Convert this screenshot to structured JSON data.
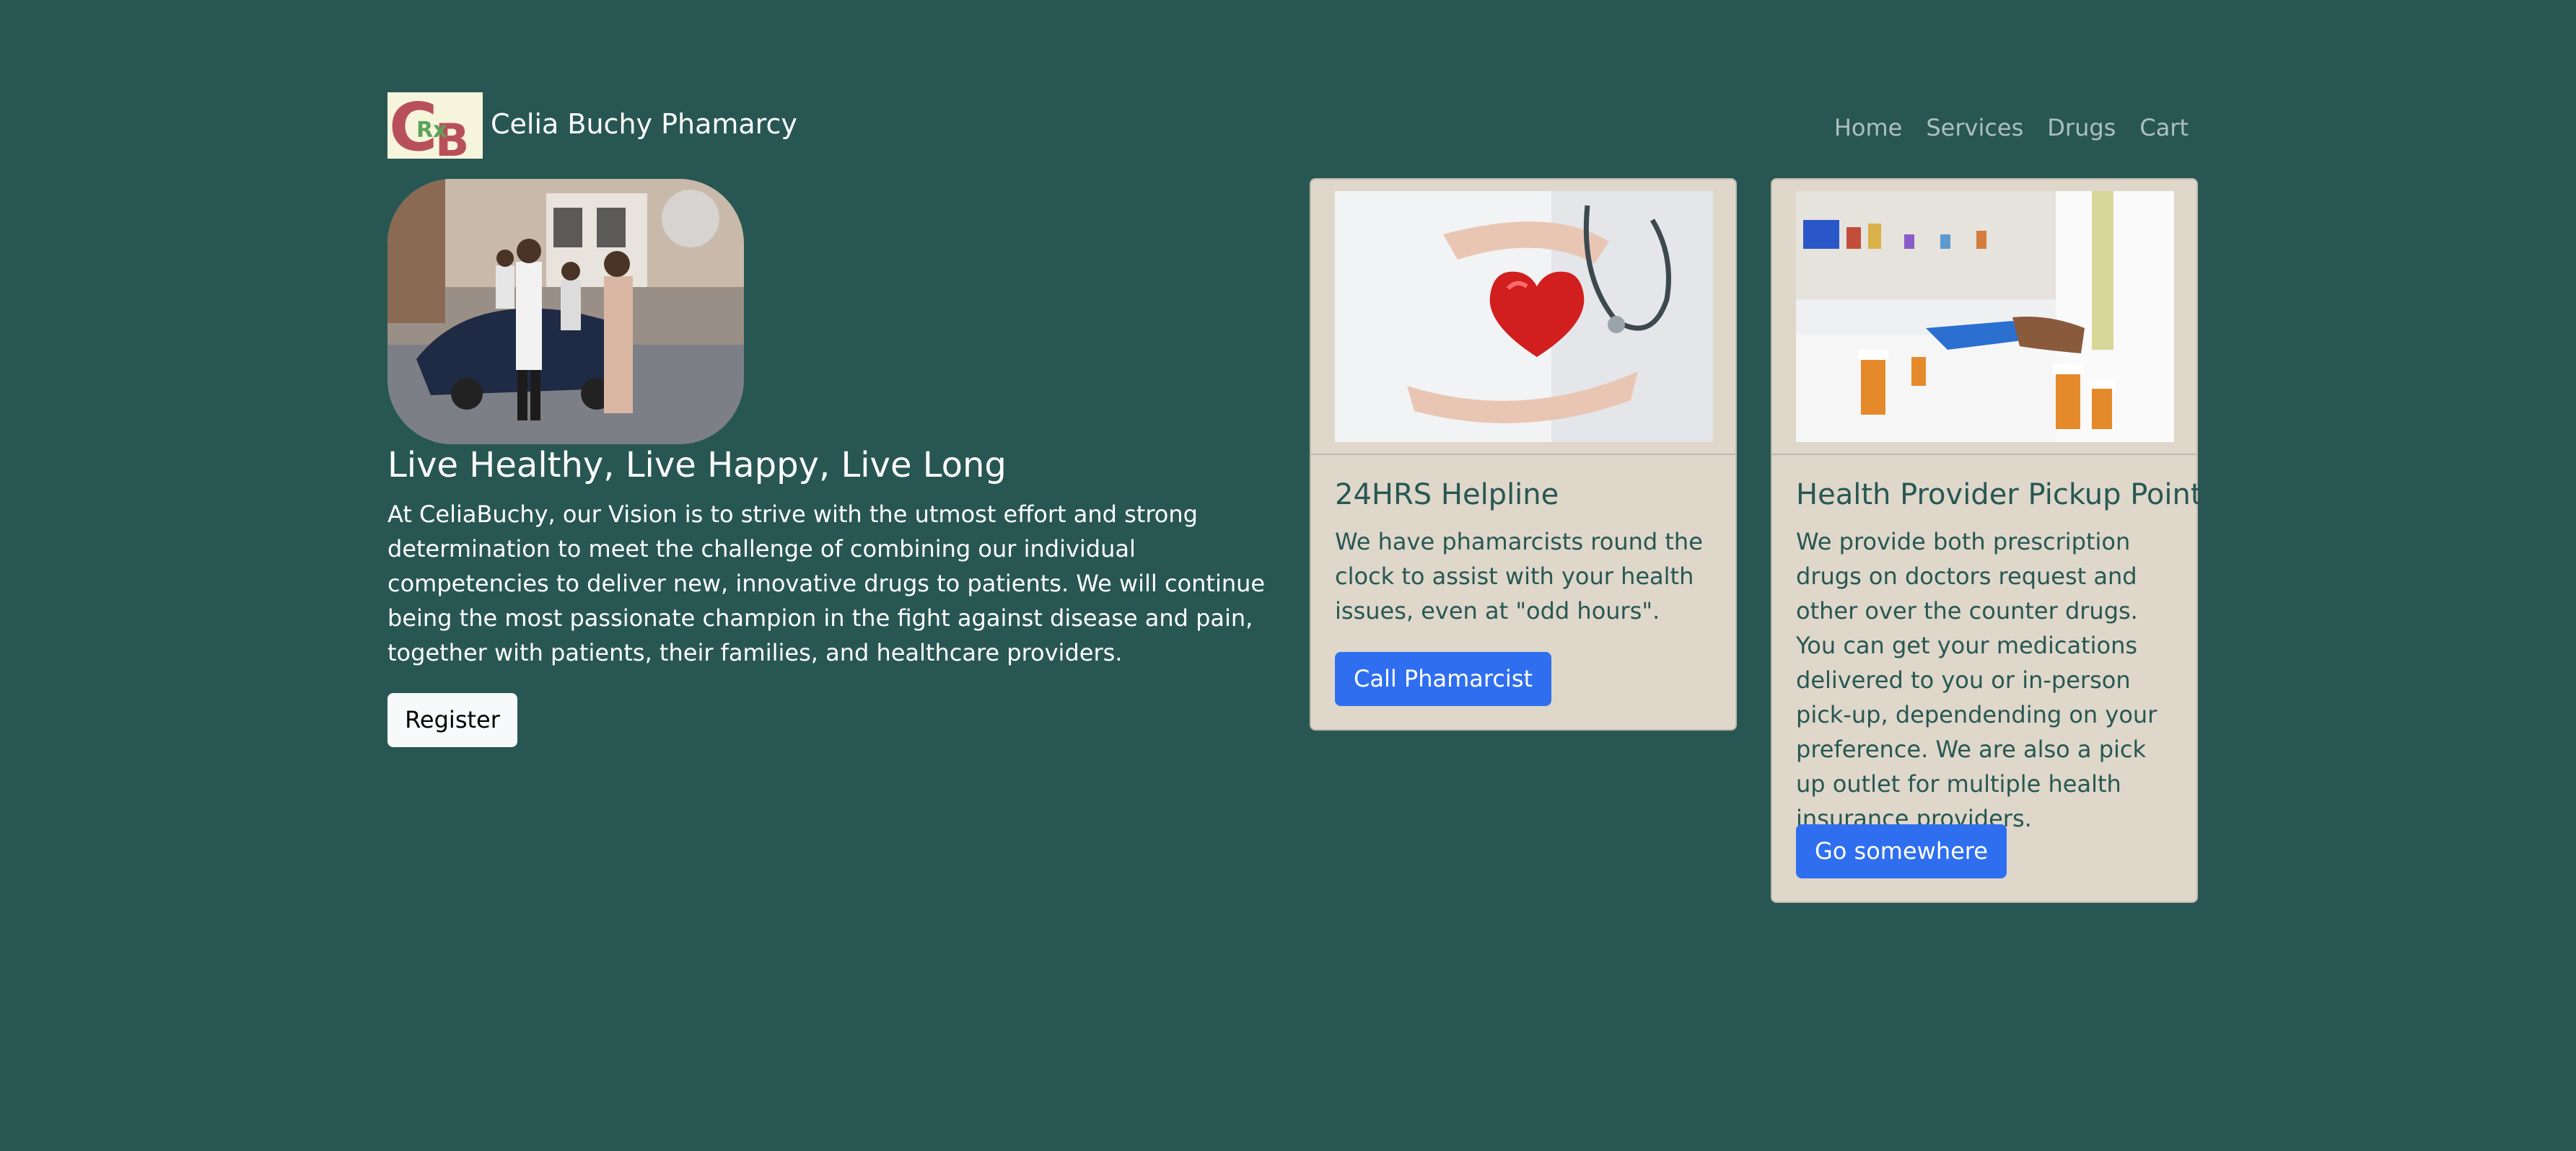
{
  "header": {
    "logo_alt": "CB logo",
    "brand": "Celia Buchy Phamarcy",
    "nav": [
      {
        "label": "Home"
      },
      {
        "label": "Services"
      },
      {
        "label": "Drugs"
      },
      {
        "label": "Cart"
      }
    ]
  },
  "hero": {
    "image_alt": "family photo",
    "title": "Live Healthy, Live Happy, Live Long",
    "text": "At CeliaBuchy, our Vision is to strive with the utmost effort and strong determination to meet the challenge of combining our individual competencies to deliver new, innovative drugs to patients. We will continue being the most passionate champion in the fight against disease and pain, together with patients, their families, and healthcare providers.",
    "register_label": "Register"
  },
  "cards": [
    {
      "image_alt": "hands holding heart with stethoscope",
      "title": "24HRS Helpline",
      "text": "We have phamarcists round the clock to assist with your health issues, even at \"odd hours\".",
      "button": "Call Phamarcist"
    },
    {
      "image_alt": "pharmacist handing medication",
      "title": "Health Provider Pickup Point",
      "text": "We provide both prescription drugs on doctors request and other over the counter drugs. You can get your medications delivered to you or in-person pick-up, dependending on your preference. We are also a pick up outlet for multiple health insurance providers.",
      "button": "Go somewhere"
    }
  ],
  "colors": {
    "background": "#285753",
    "card": "#ded7ca",
    "primary_button": "#2f6fef",
    "light_button": "#f8f9fa"
  }
}
